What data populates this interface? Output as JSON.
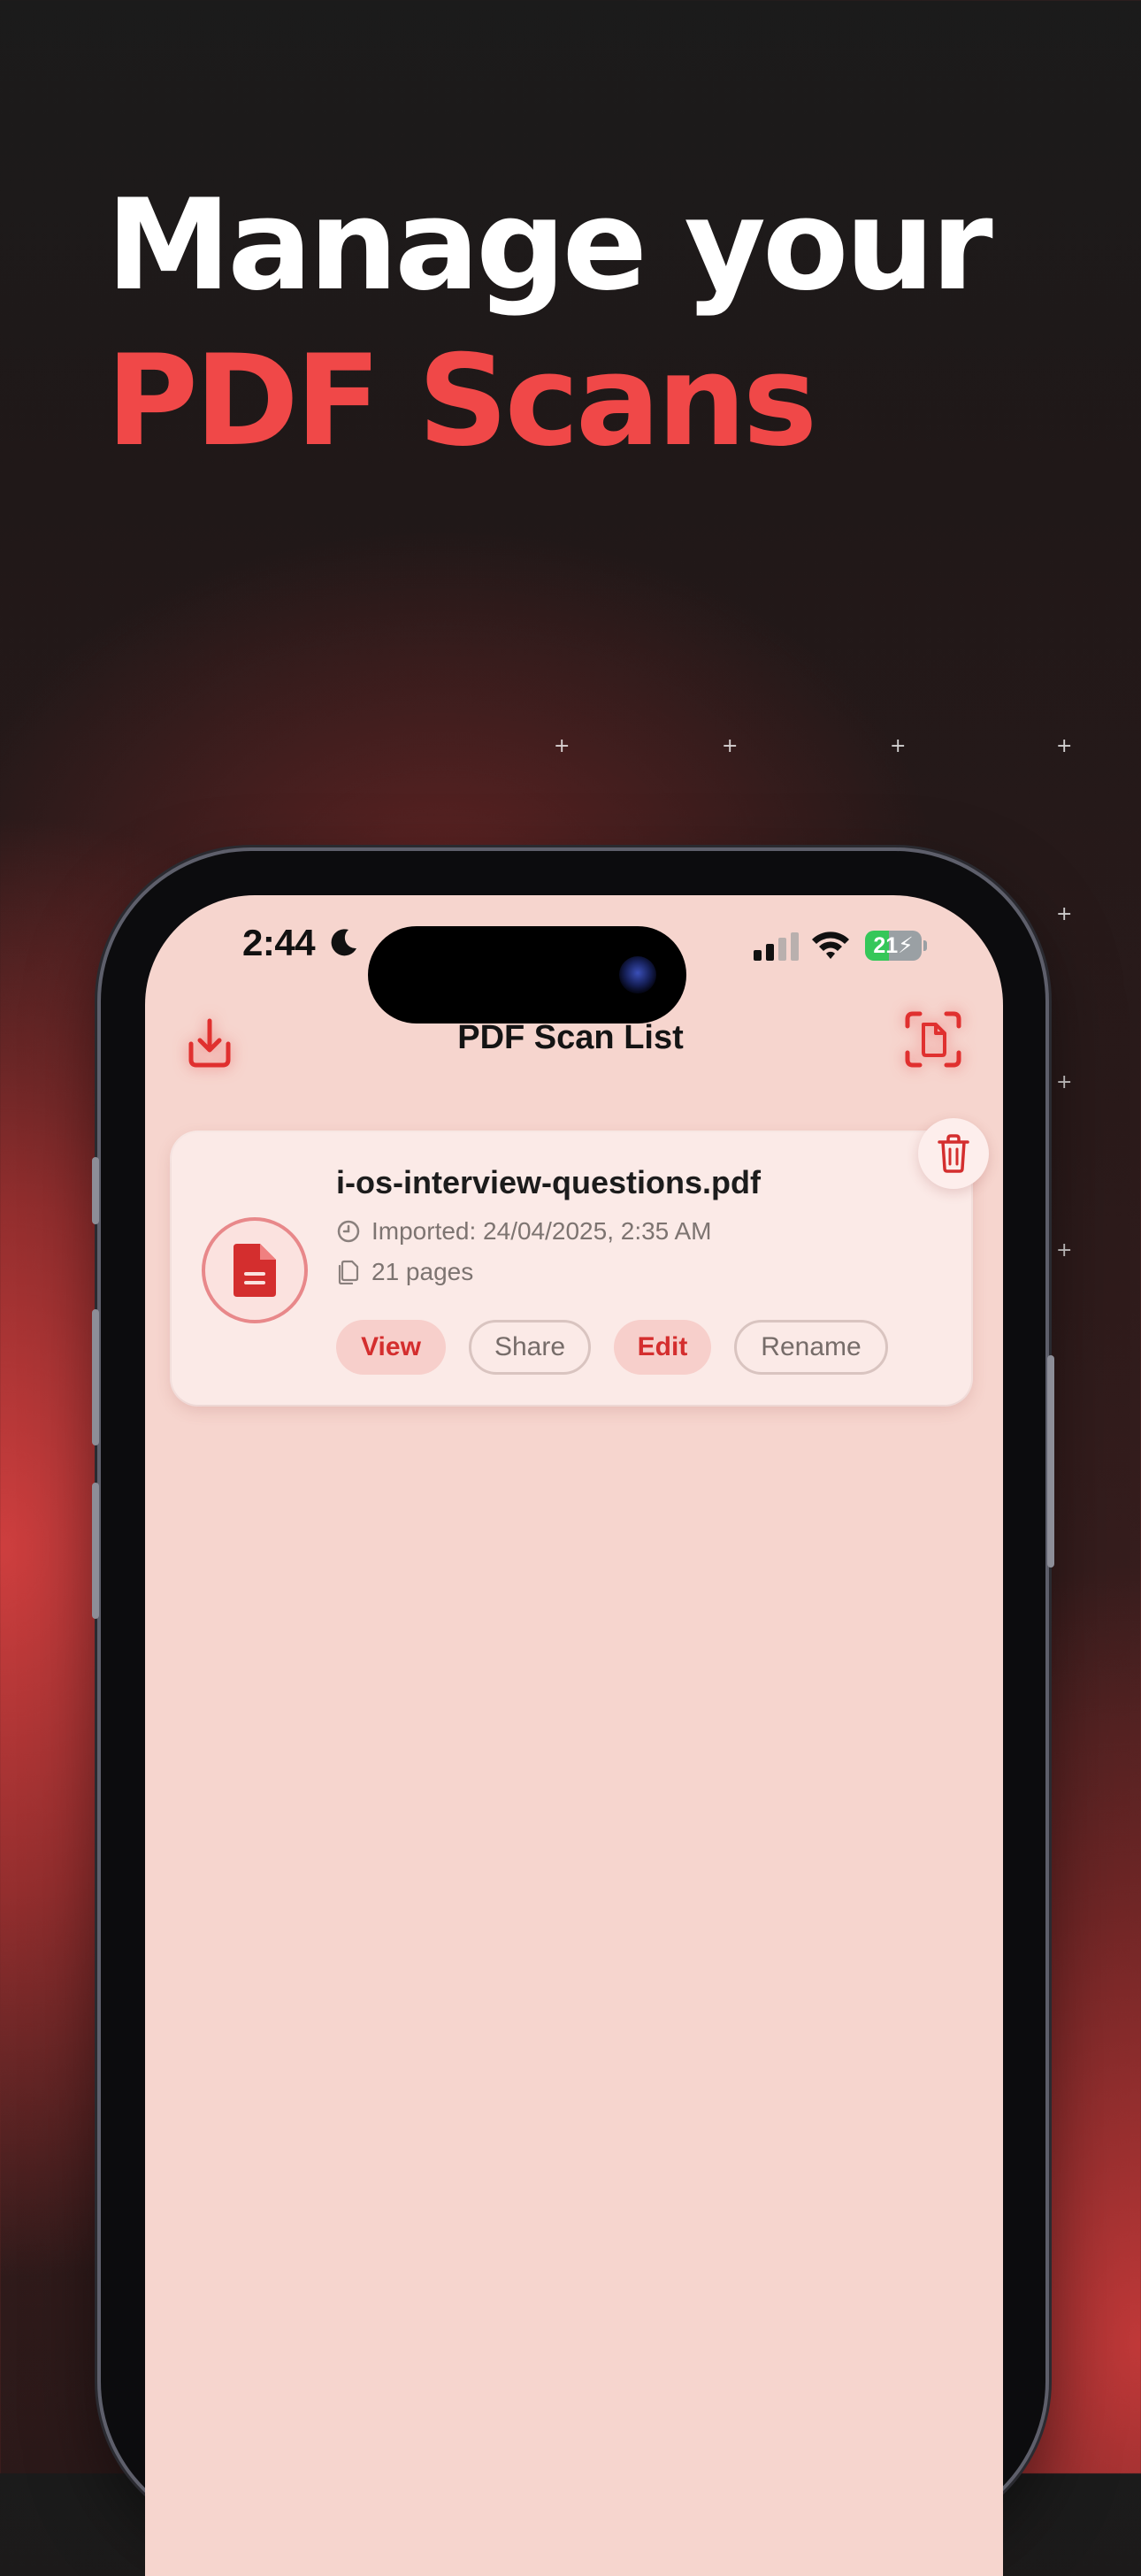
{
  "headline": {
    "line1": "Manage your",
    "line2": "PDF Scans"
  },
  "colors": {
    "accent": "#f04848",
    "screen_bg": "#f6d5ce",
    "card_bg": "#fbeae7",
    "chip_primary_text": "#d42e2e"
  },
  "status_bar": {
    "time": "2:44",
    "battery": "21",
    "icons": [
      "moon-icon",
      "cellular-signal-icon",
      "wifi-icon",
      "battery-charging-icon"
    ]
  },
  "nav": {
    "title": "PDF Scan List",
    "left_icon": "import-download-icon",
    "right_icon": "document-scan-icon"
  },
  "files": [
    {
      "name": "i-os-interview-questions.pdf",
      "imported": "Imported: 24/04/2025, 2:35 AM",
      "pages": "21 pages",
      "actions": {
        "view": "View",
        "share": "Share",
        "edit": "Edit",
        "rename": "Rename"
      },
      "delete_icon": "trash-icon"
    }
  ]
}
